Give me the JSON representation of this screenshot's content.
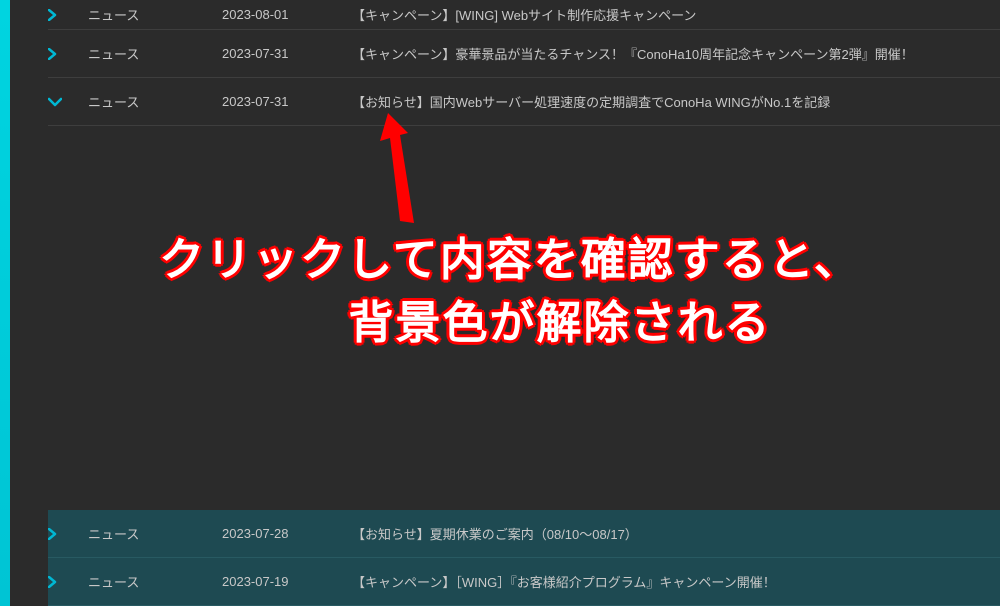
{
  "annotation": {
    "line1": "クリックして内容を確認すると、",
    "line2": "背景色が解除される"
  },
  "colors": {
    "accent": "#00b8d4",
    "highlightBg": "#1e4a52",
    "bg": "#2b2b2b"
  },
  "topRows": [
    {
      "category": "ニュース",
      "date": "2023-08-01",
      "title": "【キャンペーン】[WING] Webサイト制作応援キャンペーン",
      "expanded": false,
      "highlighted": false
    },
    {
      "category": "ニュース",
      "date": "2023-07-31",
      "title": "【キャンペーン】豪華景品が当たるチャンス！『ConoHa10周年記念キャンペーン第2弾』開催！",
      "expanded": false,
      "highlighted": false
    },
    {
      "category": "ニュース",
      "date": "2023-07-31",
      "title": "【お知らせ】国内Webサーバー処理速度の定期調査でConoHa WINGがNo.1を記録",
      "expanded": true,
      "highlighted": false
    }
  ],
  "bottomRows": [
    {
      "category": "ニュース",
      "date": "2023-07-28",
      "title": "【お知らせ】夏期休業のご案内（08/10～08/17）",
      "expanded": false,
      "highlighted": true
    },
    {
      "category": "ニュース",
      "date": "2023-07-19",
      "title": "【キャンペーン】［WING］『お客様紹介プログラム』キャンペーン開催！",
      "expanded": false,
      "highlighted": true
    }
  ]
}
